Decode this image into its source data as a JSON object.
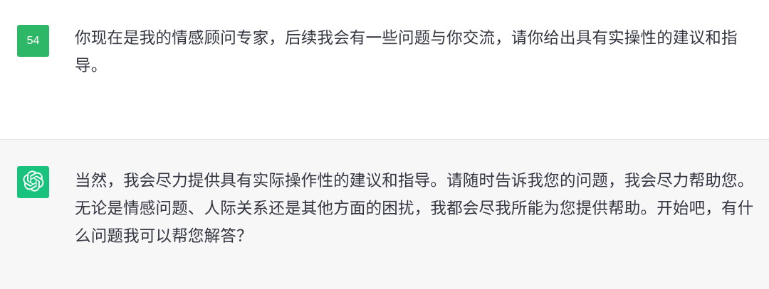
{
  "messages": {
    "user": {
      "avatar_text": "54",
      "text": "你现在是我的情感顾问专家，后续我会有一些问题与你交流，请你给出具有实操性的建议和指导。"
    },
    "assistant": {
      "avatar_icon": "openai-logo-icon",
      "text": "当然，我会尽力提供具有实际操作性的建议和指导。请随时告诉我您的问题，我会尽力帮助您。无论是情感问题、人际关系还是其他方面的困扰，我都会尽我所能为您提供帮助。开始吧，有什么问题我可以帮您解答？"
    }
  },
  "colors": {
    "user_avatar_bg": "#2eb767",
    "assistant_avatar_bg": "#19c37d",
    "assistant_row_bg": "#f7f7f8",
    "text": "#343541"
  }
}
